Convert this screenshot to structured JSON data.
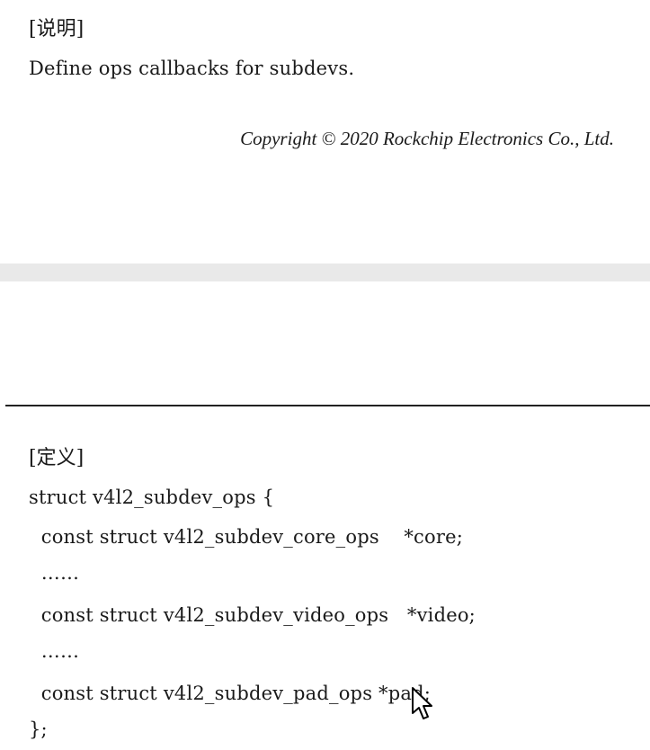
{
  "top_section": {
    "heading": "[说明]",
    "description": "Define ops callbacks for subdevs.",
    "copyright": "Copyright © 2020 Rockchip Electronics Co., Ltd."
  },
  "bottom_section": {
    "heading": "[定义]",
    "code_lines": [
      "struct v4l2_subdev_ops {",
      "  const struct v4l2_subdev_core_ops    *core;",
      "  ……",
      "  const struct v4l2_subdev_video_ops   *video;",
      "  ……",
      "  const struct v4l2_subdev_pad_ops *pad;",
      "};"
    ]
  }
}
